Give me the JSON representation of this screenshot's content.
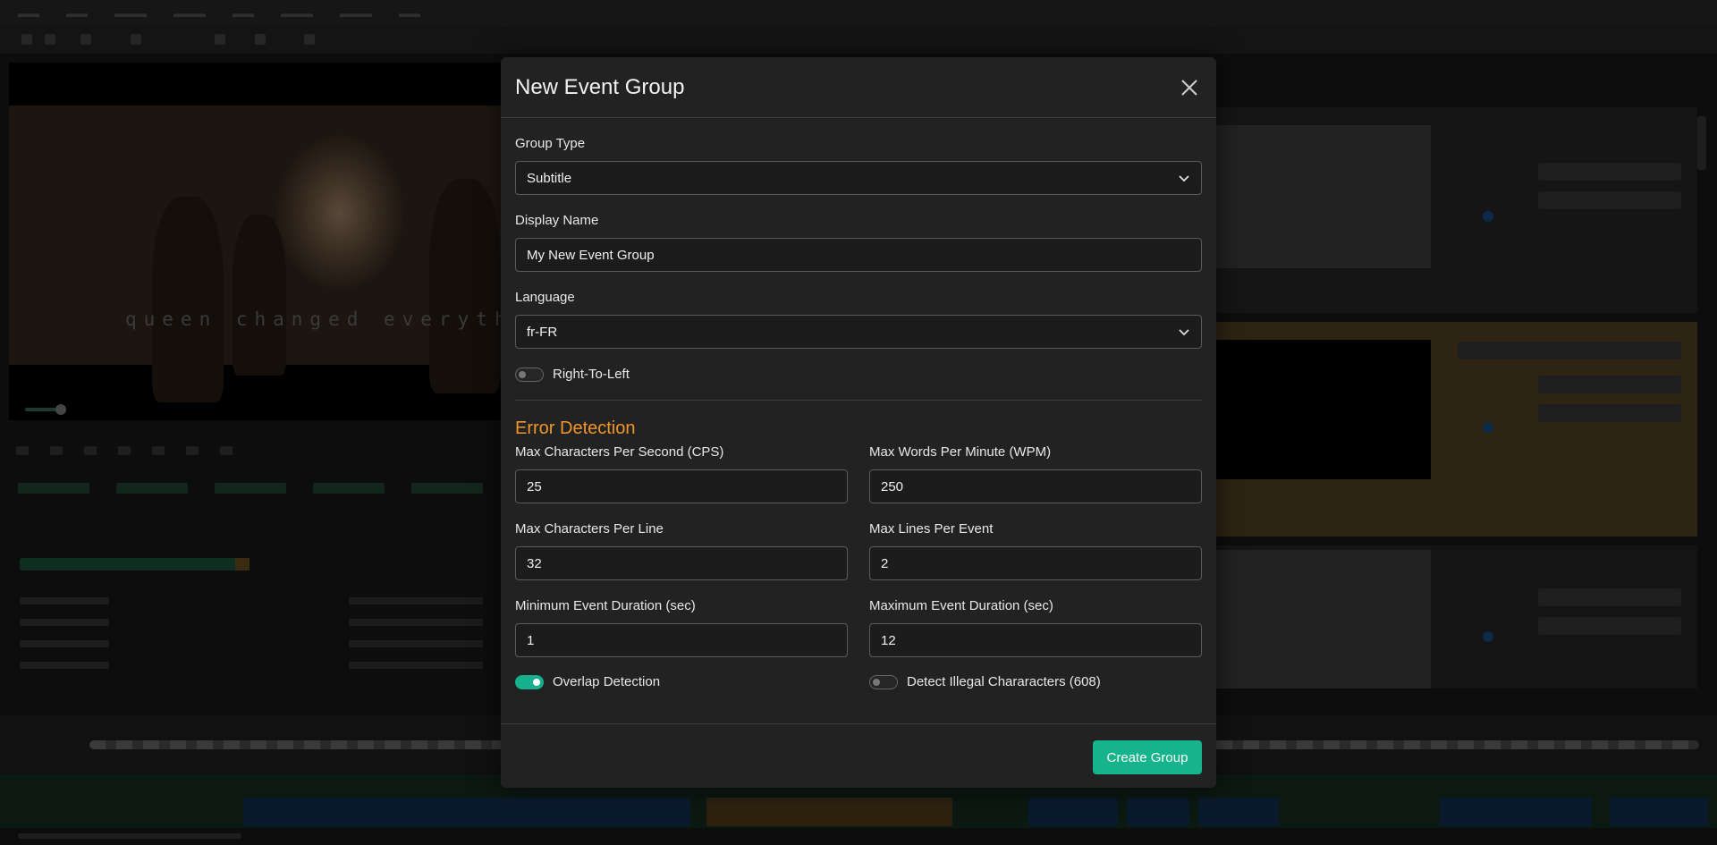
{
  "modal": {
    "title": "New Event Group",
    "group_type": {
      "label": "Group Type",
      "value": "Subtitle"
    },
    "display_name": {
      "label": "Display Name",
      "value": "My New Event Group"
    },
    "language": {
      "label": "Language",
      "value": "fr-FR"
    },
    "rtl": {
      "label": "Right-To-Left",
      "enabled": false
    },
    "error_detection": {
      "title": "Error Detection",
      "max_cps": {
        "label": "Max Characters Per Second (CPS)",
        "value": "25"
      },
      "max_wpm": {
        "label": "Max Words Per Minute (WPM)",
        "value": "250"
      },
      "max_cpl": {
        "label": "Max Characters Per Line",
        "value": "32"
      },
      "max_lines": {
        "label": "Max Lines Per Event",
        "value": "2"
      },
      "min_duration": {
        "label": "Minimum Event Duration (sec)",
        "value": "1"
      },
      "max_duration": {
        "label": "Maximum Event Duration (sec)",
        "value": "12"
      },
      "overlap": {
        "label": "Overlap Detection",
        "enabled": true
      },
      "illegal_chars": {
        "label": "Detect Illegal Chararacters (608)",
        "enabled": false
      }
    },
    "create_label": "Create Group"
  },
  "background": {
    "caption": "queen changed everythi"
  },
  "colors": {
    "accent": "#16b48c",
    "section_title": "#f0962a",
    "modal_bg": "#222222"
  }
}
